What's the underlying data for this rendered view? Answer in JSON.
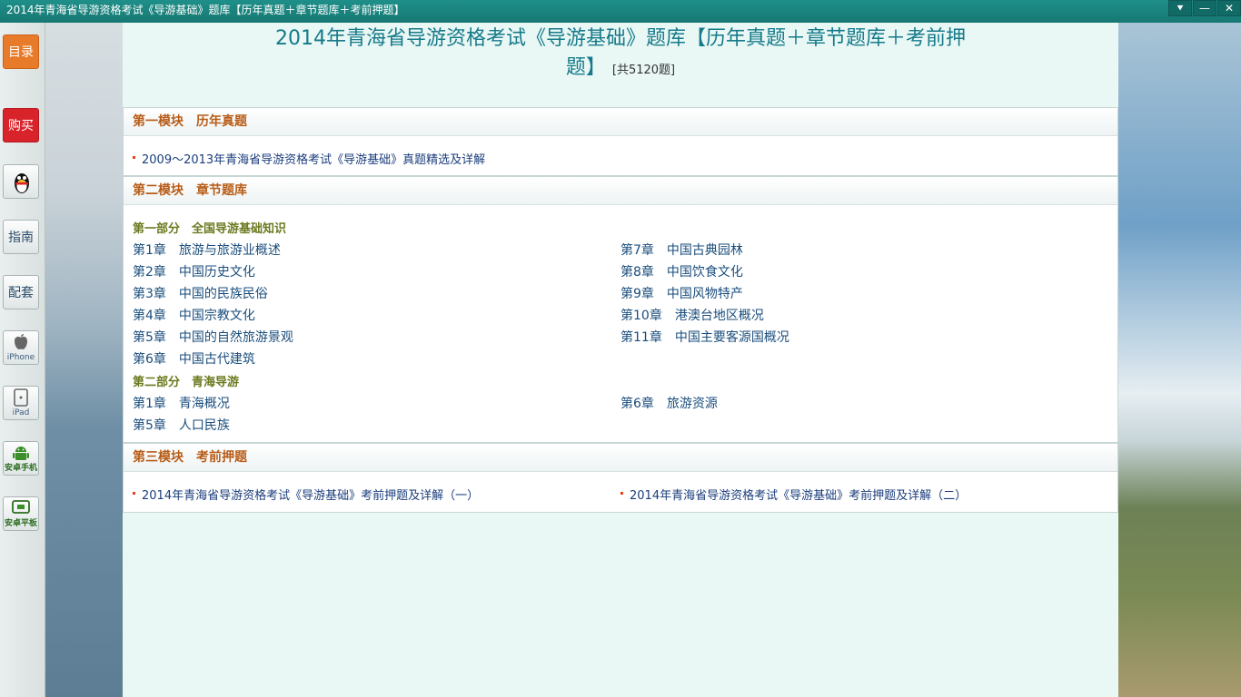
{
  "window": {
    "title": "2014年青海省导游资格考试《导游基础》题库【历年真题＋章节题库＋考前押题】",
    "buttons": {
      "dropdown": "⯆",
      "minimize": "—",
      "close": "✕"
    }
  },
  "sidebar": {
    "items": [
      {
        "label": "目录",
        "name": "catalog"
      },
      {
        "label": "购买",
        "name": "buy"
      },
      {
        "label": "",
        "name": "qq",
        "icon": "qq-penguin-icon"
      },
      {
        "label": "指南",
        "name": "guide"
      },
      {
        "label": "配套",
        "name": "bundle"
      },
      {
        "label": "iPhone",
        "name": "iphone",
        "icon": "apple-icon"
      },
      {
        "label": "iPad",
        "name": "ipad",
        "icon": "tablet-icon"
      },
      {
        "label": "安卓手机",
        "name": "android-phone",
        "icon": "android-icon"
      },
      {
        "label": "安卓平板",
        "name": "android-tablet",
        "icon": "android-tablet-icon"
      }
    ]
  },
  "main": {
    "title_line1": "2014年青海省导游资格考试《导游基础》题库【历年真题＋章节题库＋考前押",
    "title_line2": "题】",
    "count": "[共5120题]",
    "section1": {
      "header": "第一模块　历年真题",
      "items": [
        "2009～2013年青海省导游资格考试《导游基础》真题精选及详解"
      ]
    },
    "section2": {
      "header": "第二模块　章节题库",
      "part1": {
        "title": "第一部分　全国导游基础知识",
        "left": [
          {
            "num": "第1章",
            "title": "旅游与旅游业概述"
          },
          {
            "num": "第2章",
            "title": "中国历史文化"
          },
          {
            "num": "第3章",
            "title": "中国的民族民俗"
          },
          {
            "num": "第4章",
            "title": "中国宗教文化"
          },
          {
            "num": "第5章",
            "title": "中国的自然旅游景观"
          },
          {
            "num": "第6章",
            "title": "中国古代建筑"
          }
        ],
        "right": [
          {
            "num": "第7章",
            "title": "中国古典园林"
          },
          {
            "num": "第8章",
            "title": "中国饮食文化"
          },
          {
            "num": "第9章",
            "title": "中国风物特产"
          },
          {
            "num": "第10章",
            "title": "港澳台地区概况"
          },
          {
            "num": "第11章",
            "title": "中国主要客源国概况"
          }
        ]
      },
      "part2": {
        "title": "第二部分　青海导游",
        "left": [
          {
            "num": "第1章",
            "title": "青海概况"
          },
          {
            "num": "第5章",
            "title": "人口民族"
          }
        ],
        "right": [
          {
            "num": "第6章",
            "title": "旅游资源"
          }
        ]
      }
    },
    "section3": {
      "header": "第三模块　考前押题",
      "items": [
        "2014年青海省导游资格考试《导游基础》考前押题及详解（一）",
        "2014年青海省导游资格考试《导游基础》考前押题及详解（二）"
      ]
    }
  }
}
